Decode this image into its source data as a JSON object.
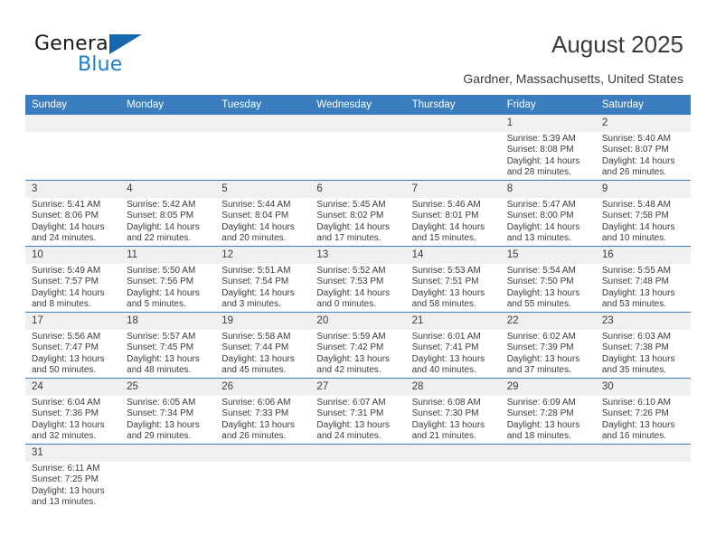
{
  "logo": {
    "word_top": "General",
    "word_bottom": "Blue",
    "accent_color": "#1668ae"
  },
  "header": {
    "title": "August 2025",
    "subtitle": "Gardner, Massachusetts, United States",
    "header_bg": "#3a7ebf",
    "daynum_bg": "#f0f0f0"
  },
  "weekdays": [
    "Sunday",
    "Monday",
    "Tuesday",
    "Wednesday",
    "Thursday",
    "Friday",
    "Saturday"
  ],
  "labels": {
    "sunrise_prefix": "Sunrise:",
    "sunset_prefix": "Sunset:",
    "daylight_prefix": "Daylight:"
  },
  "weeks": [
    [
      {
        "day": "",
        "blank": true
      },
      {
        "day": "",
        "blank": true
      },
      {
        "day": "",
        "blank": true
      },
      {
        "day": "",
        "blank": true
      },
      {
        "day": "",
        "blank": true
      },
      {
        "day": "1",
        "sunrise": "Sunrise: 5:39 AM",
        "sunset": "Sunset: 8:08 PM",
        "daylight_1": "Daylight: 14 hours",
        "daylight_2": "and 28 minutes."
      },
      {
        "day": "2",
        "sunrise": "Sunrise: 5:40 AM",
        "sunset": "Sunset: 8:07 PM",
        "daylight_1": "Daylight: 14 hours",
        "daylight_2": "and 26 minutes."
      }
    ],
    [
      {
        "day": "3",
        "sunrise": "Sunrise: 5:41 AM",
        "sunset": "Sunset: 8:06 PM",
        "daylight_1": "Daylight: 14 hours",
        "daylight_2": "and 24 minutes."
      },
      {
        "day": "4",
        "sunrise": "Sunrise: 5:42 AM",
        "sunset": "Sunset: 8:05 PM",
        "daylight_1": "Daylight: 14 hours",
        "daylight_2": "and 22 minutes."
      },
      {
        "day": "5",
        "sunrise": "Sunrise: 5:44 AM",
        "sunset": "Sunset: 8:04 PM",
        "daylight_1": "Daylight: 14 hours",
        "daylight_2": "and 20 minutes."
      },
      {
        "day": "6",
        "sunrise": "Sunrise: 5:45 AM",
        "sunset": "Sunset: 8:02 PM",
        "daylight_1": "Daylight: 14 hours",
        "daylight_2": "and 17 minutes."
      },
      {
        "day": "7",
        "sunrise": "Sunrise: 5:46 AM",
        "sunset": "Sunset: 8:01 PM",
        "daylight_1": "Daylight: 14 hours",
        "daylight_2": "and 15 minutes."
      },
      {
        "day": "8",
        "sunrise": "Sunrise: 5:47 AM",
        "sunset": "Sunset: 8:00 PM",
        "daylight_1": "Daylight: 14 hours",
        "daylight_2": "and 13 minutes."
      },
      {
        "day": "9",
        "sunrise": "Sunrise: 5:48 AM",
        "sunset": "Sunset: 7:58 PM",
        "daylight_1": "Daylight: 14 hours",
        "daylight_2": "and 10 minutes."
      }
    ],
    [
      {
        "day": "10",
        "sunrise": "Sunrise: 5:49 AM",
        "sunset": "Sunset: 7:57 PM",
        "daylight_1": "Daylight: 14 hours",
        "daylight_2": "and 8 minutes."
      },
      {
        "day": "11",
        "sunrise": "Sunrise: 5:50 AM",
        "sunset": "Sunset: 7:56 PM",
        "daylight_1": "Daylight: 14 hours",
        "daylight_2": "and 5 minutes."
      },
      {
        "day": "12",
        "sunrise": "Sunrise: 5:51 AM",
        "sunset": "Sunset: 7:54 PM",
        "daylight_1": "Daylight: 14 hours",
        "daylight_2": "and 3 minutes."
      },
      {
        "day": "13",
        "sunrise": "Sunrise: 5:52 AM",
        "sunset": "Sunset: 7:53 PM",
        "daylight_1": "Daylight: 14 hours",
        "daylight_2": "and 0 minutes."
      },
      {
        "day": "14",
        "sunrise": "Sunrise: 5:53 AM",
        "sunset": "Sunset: 7:51 PM",
        "daylight_1": "Daylight: 13 hours",
        "daylight_2": "and 58 minutes."
      },
      {
        "day": "15",
        "sunrise": "Sunrise: 5:54 AM",
        "sunset": "Sunset: 7:50 PM",
        "daylight_1": "Daylight: 13 hours",
        "daylight_2": "and 55 minutes."
      },
      {
        "day": "16",
        "sunrise": "Sunrise: 5:55 AM",
        "sunset": "Sunset: 7:48 PM",
        "daylight_1": "Daylight: 13 hours",
        "daylight_2": "and 53 minutes."
      }
    ],
    [
      {
        "day": "17",
        "sunrise": "Sunrise: 5:56 AM",
        "sunset": "Sunset: 7:47 PM",
        "daylight_1": "Daylight: 13 hours",
        "daylight_2": "and 50 minutes."
      },
      {
        "day": "18",
        "sunrise": "Sunrise: 5:57 AM",
        "sunset": "Sunset: 7:45 PM",
        "daylight_1": "Daylight: 13 hours",
        "daylight_2": "and 48 minutes."
      },
      {
        "day": "19",
        "sunrise": "Sunrise: 5:58 AM",
        "sunset": "Sunset: 7:44 PM",
        "daylight_1": "Daylight: 13 hours",
        "daylight_2": "and 45 minutes."
      },
      {
        "day": "20",
        "sunrise": "Sunrise: 5:59 AM",
        "sunset": "Sunset: 7:42 PM",
        "daylight_1": "Daylight: 13 hours",
        "daylight_2": "and 42 minutes."
      },
      {
        "day": "21",
        "sunrise": "Sunrise: 6:01 AM",
        "sunset": "Sunset: 7:41 PM",
        "daylight_1": "Daylight: 13 hours",
        "daylight_2": "and 40 minutes."
      },
      {
        "day": "22",
        "sunrise": "Sunrise: 6:02 AM",
        "sunset": "Sunset: 7:39 PM",
        "daylight_1": "Daylight: 13 hours",
        "daylight_2": "and 37 minutes."
      },
      {
        "day": "23",
        "sunrise": "Sunrise: 6:03 AM",
        "sunset": "Sunset: 7:38 PM",
        "daylight_1": "Daylight: 13 hours",
        "daylight_2": "and 35 minutes."
      }
    ],
    [
      {
        "day": "24",
        "sunrise": "Sunrise: 6:04 AM",
        "sunset": "Sunset: 7:36 PM",
        "daylight_1": "Daylight: 13 hours",
        "daylight_2": "and 32 minutes."
      },
      {
        "day": "25",
        "sunrise": "Sunrise: 6:05 AM",
        "sunset": "Sunset: 7:34 PM",
        "daylight_1": "Daylight: 13 hours",
        "daylight_2": "and 29 minutes."
      },
      {
        "day": "26",
        "sunrise": "Sunrise: 6:06 AM",
        "sunset": "Sunset: 7:33 PM",
        "daylight_1": "Daylight: 13 hours",
        "daylight_2": "and 26 minutes."
      },
      {
        "day": "27",
        "sunrise": "Sunrise: 6:07 AM",
        "sunset": "Sunset: 7:31 PM",
        "daylight_1": "Daylight: 13 hours",
        "daylight_2": "and 24 minutes."
      },
      {
        "day": "28",
        "sunrise": "Sunrise: 6:08 AM",
        "sunset": "Sunset: 7:30 PM",
        "daylight_1": "Daylight: 13 hours",
        "daylight_2": "and 21 minutes."
      },
      {
        "day": "29",
        "sunrise": "Sunrise: 6:09 AM",
        "sunset": "Sunset: 7:28 PM",
        "daylight_1": "Daylight: 13 hours",
        "daylight_2": "and 18 minutes."
      },
      {
        "day": "30",
        "sunrise": "Sunrise: 6:10 AM",
        "sunset": "Sunset: 7:26 PM",
        "daylight_1": "Daylight: 13 hours",
        "daylight_2": "and 16 minutes."
      }
    ],
    [
      {
        "day": "31",
        "sunrise": "Sunrise: 6:11 AM",
        "sunset": "Sunset: 7:25 PM",
        "daylight_1": "Daylight: 13 hours",
        "daylight_2": "and 13 minutes."
      },
      {
        "day": "",
        "blank": true
      },
      {
        "day": "",
        "blank": true
      },
      {
        "day": "",
        "blank": true
      },
      {
        "day": "",
        "blank": true
      },
      {
        "day": "",
        "blank": true
      },
      {
        "day": "",
        "blank": true
      }
    ]
  ]
}
